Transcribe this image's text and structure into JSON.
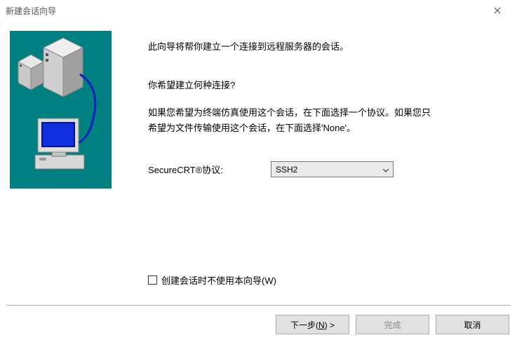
{
  "title": "新建会话向导",
  "intro": "此向导将帮你建立一个连接到远程服务器的会话。",
  "question": "你希望建立何种连接?",
  "hint_line1": "如果您希望为终端仿真使用这个会话，在下面选择一个协议。如果您只",
  "hint_line2": "希望为文件传输使用这个会话，在下面选择'None'。",
  "protocol_label": "SecureCRT®协议:",
  "protocol_value": "SSH2",
  "checkbox_label": "创建会话时不使用本向导(W)",
  "buttons": {
    "next_prefix": "下一步(",
    "next_ul": "N",
    "next_suffix": ") >",
    "finish": "完成",
    "cancel": "取消"
  }
}
